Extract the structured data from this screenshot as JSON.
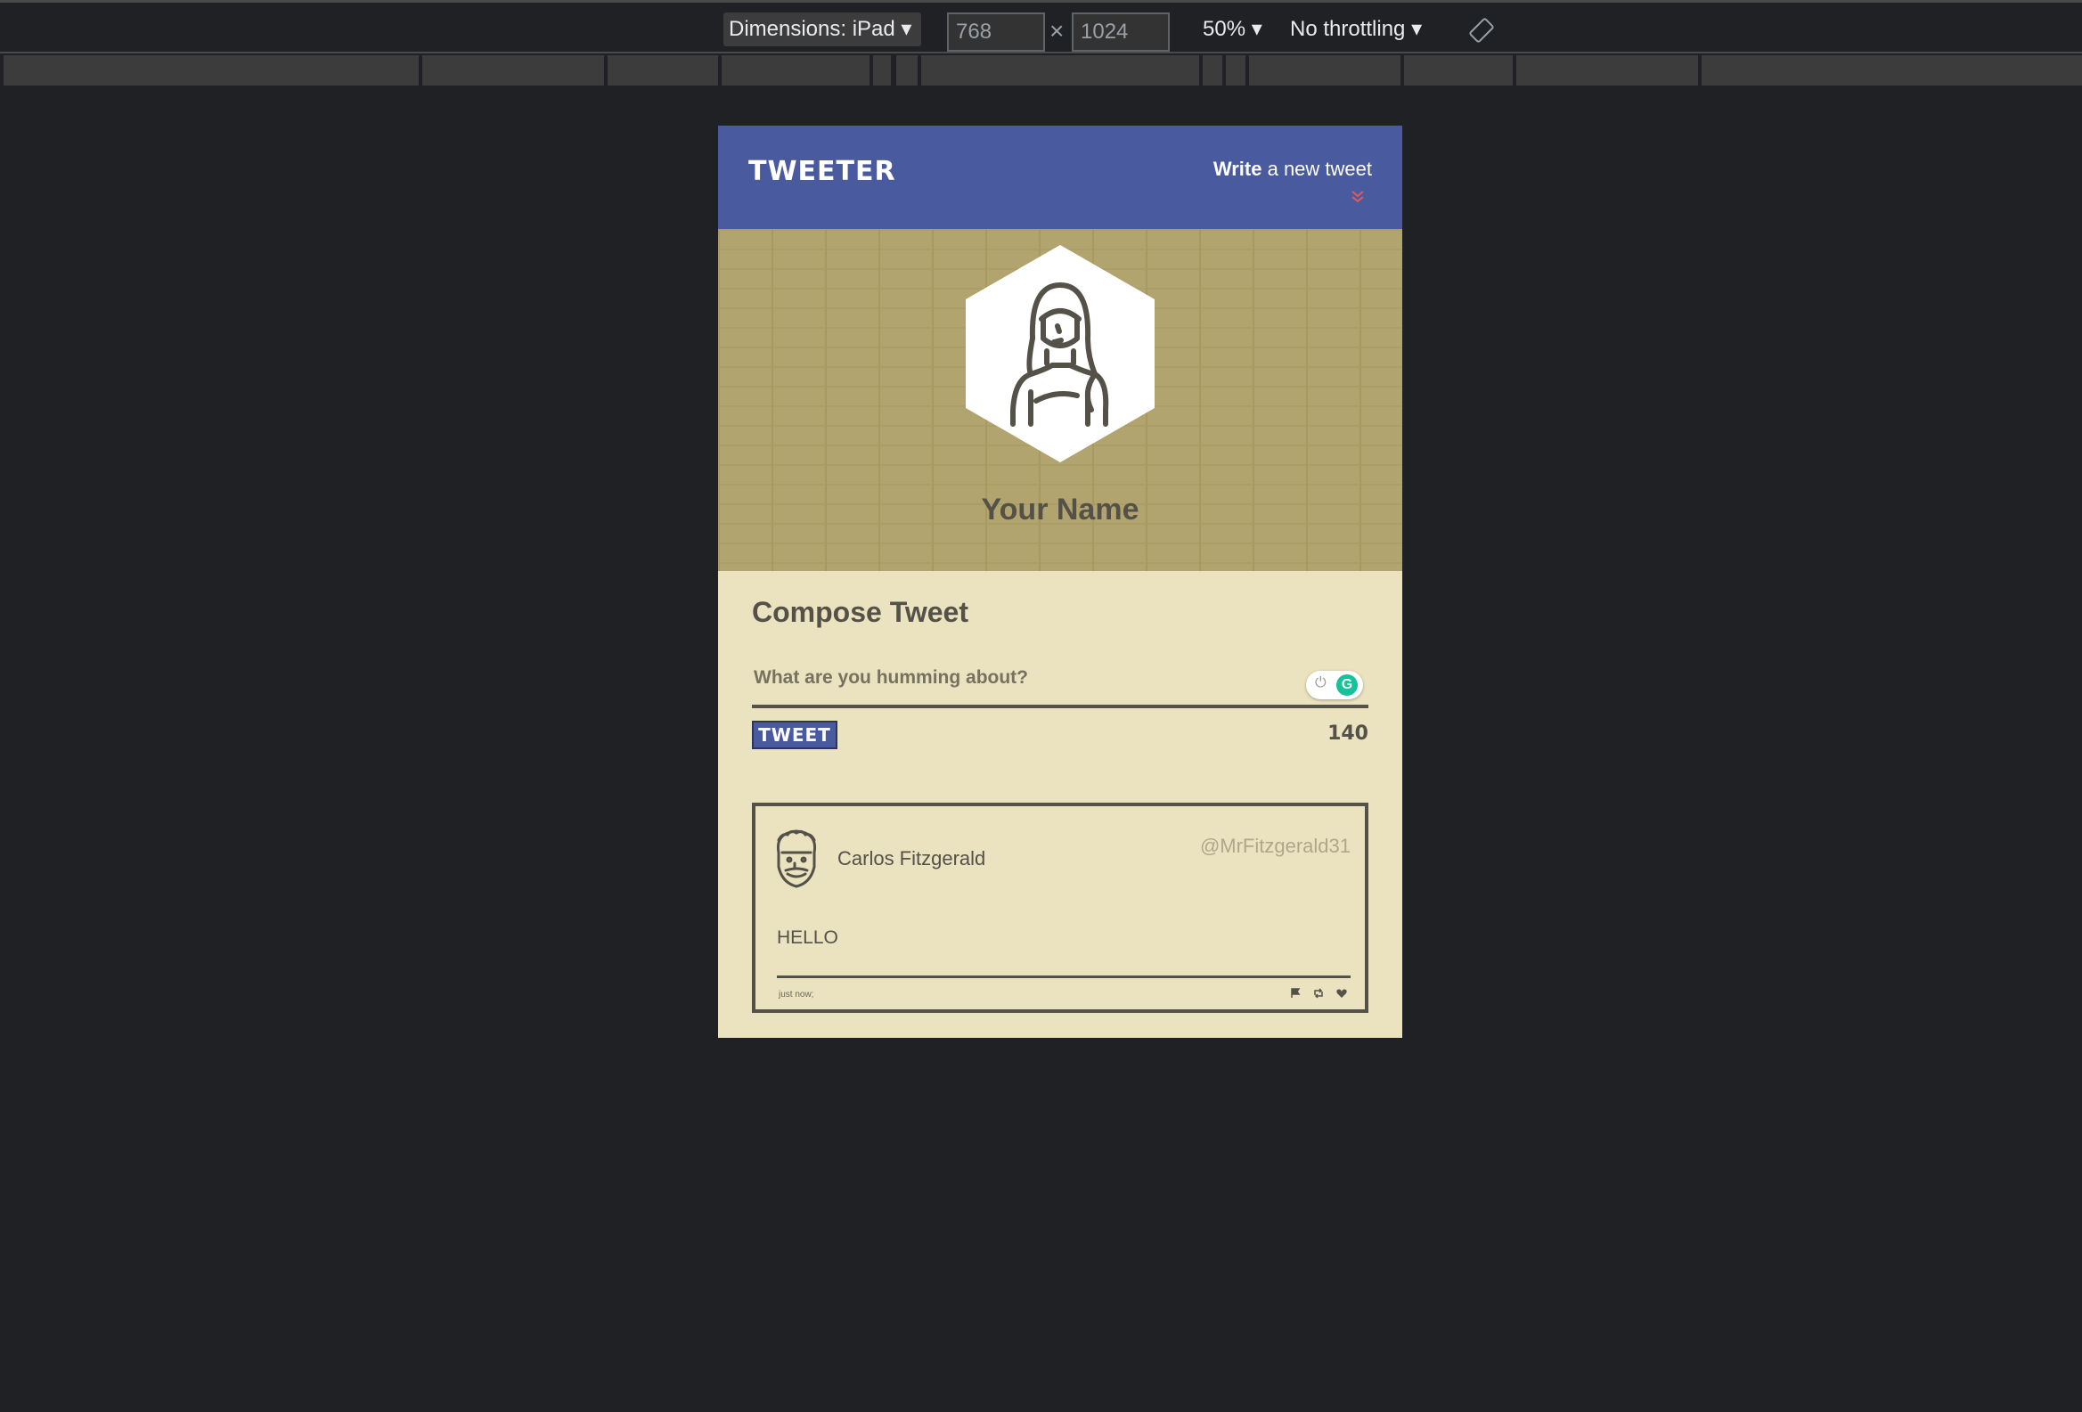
{
  "devtools": {
    "device": "Dimensions: iPad ▾",
    "width": "768",
    "height": "1024",
    "times": "×",
    "zoom": "50% ▾",
    "throttling": "No throttling ▾"
  },
  "nav": {
    "logo": "TWEETER",
    "write_bold": "Write",
    "write_rest": "a new tweet",
    "chevron": "⌄⌄"
  },
  "profile": {
    "name": "Your Name"
  },
  "compose": {
    "title": "Compose Tweet",
    "placeholder": "What are you humming about?",
    "button": "TWEET",
    "counter": "140"
  },
  "tweet": {
    "author": "Carlos Fitzgerald",
    "handle": "@MrFitzgerald31",
    "body": "HELLO",
    "time": "just now;"
  },
  "colors": {
    "nav": "#4a5a9e",
    "header": "#b2a46e",
    "body": "#ebe2bf",
    "text": "#545149",
    "accent": "#e25a5a"
  }
}
